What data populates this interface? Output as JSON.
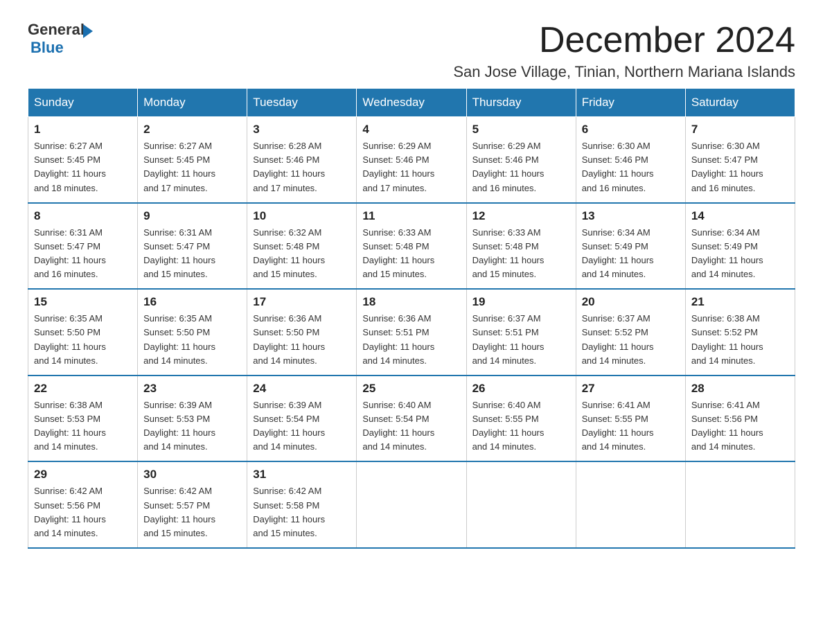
{
  "header": {
    "logo": {
      "general": "General",
      "blue": "Blue",
      "arrow": "▶"
    },
    "month_year": "December 2024",
    "location": "San Jose Village, Tinian, Northern Mariana Islands"
  },
  "weekdays": [
    "Sunday",
    "Monday",
    "Tuesday",
    "Wednesday",
    "Thursday",
    "Friday",
    "Saturday"
  ],
  "weeks": [
    [
      {
        "day": "1",
        "sunrise": "6:27 AM",
        "sunset": "5:45 PM",
        "daylight": "11 hours and 18 minutes."
      },
      {
        "day": "2",
        "sunrise": "6:27 AM",
        "sunset": "5:45 PM",
        "daylight": "11 hours and 17 minutes."
      },
      {
        "day": "3",
        "sunrise": "6:28 AM",
        "sunset": "5:46 PM",
        "daylight": "11 hours and 17 minutes."
      },
      {
        "day": "4",
        "sunrise": "6:29 AM",
        "sunset": "5:46 PM",
        "daylight": "11 hours and 17 minutes."
      },
      {
        "day": "5",
        "sunrise": "6:29 AM",
        "sunset": "5:46 PM",
        "daylight": "11 hours and 16 minutes."
      },
      {
        "day": "6",
        "sunrise": "6:30 AM",
        "sunset": "5:46 PM",
        "daylight": "11 hours and 16 minutes."
      },
      {
        "day": "7",
        "sunrise": "6:30 AM",
        "sunset": "5:47 PM",
        "daylight": "11 hours and 16 minutes."
      }
    ],
    [
      {
        "day": "8",
        "sunrise": "6:31 AM",
        "sunset": "5:47 PM",
        "daylight": "11 hours and 16 minutes."
      },
      {
        "day": "9",
        "sunrise": "6:31 AM",
        "sunset": "5:47 PM",
        "daylight": "11 hours and 15 minutes."
      },
      {
        "day": "10",
        "sunrise": "6:32 AM",
        "sunset": "5:48 PM",
        "daylight": "11 hours and 15 minutes."
      },
      {
        "day": "11",
        "sunrise": "6:33 AM",
        "sunset": "5:48 PM",
        "daylight": "11 hours and 15 minutes."
      },
      {
        "day": "12",
        "sunrise": "6:33 AM",
        "sunset": "5:48 PM",
        "daylight": "11 hours and 15 minutes."
      },
      {
        "day": "13",
        "sunrise": "6:34 AM",
        "sunset": "5:49 PM",
        "daylight": "11 hours and 14 minutes."
      },
      {
        "day": "14",
        "sunrise": "6:34 AM",
        "sunset": "5:49 PM",
        "daylight": "11 hours and 14 minutes."
      }
    ],
    [
      {
        "day": "15",
        "sunrise": "6:35 AM",
        "sunset": "5:50 PM",
        "daylight": "11 hours and 14 minutes."
      },
      {
        "day": "16",
        "sunrise": "6:35 AM",
        "sunset": "5:50 PM",
        "daylight": "11 hours and 14 minutes."
      },
      {
        "day": "17",
        "sunrise": "6:36 AM",
        "sunset": "5:50 PM",
        "daylight": "11 hours and 14 minutes."
      },
      {
        "day": "18",
        "sunrise": "6:36 AM",
        "sunset": "5:51 PM",
        "daylight": "11 hours and 14 minutes."
      },
      {
        "day": "19",
        "sunrise": "6:37 AM",
        "sunset": "5:51 PM",
        "daylight": "11 hours and 14 minutes."
      },
      {
        "day": "20",
        "sunrise": "6:37 AM",
        "sunset": "5:52 PM",
        "daylight": "11 hours and 14 minutes."
      },
      {
        "day": "21",
        "sunrise": "6:38 AM",
        "sunset": "5:52 PM",
        "daylight": "11 hours and 14 minutes."
      }
    ],
    [
      {
        "day": "22",
        "sunrise": "6:38 AM",
        "sunset": "5:53 PM",
        "daylight": "11 hours and 14 minutes."
      },
      {
        "day": "23",
        "sunrise": "6:39 AM",
        "sunset": "5:53 PM",
        "daylight": "11 hours and 14 minutes."
      },
      {
        "day": "24",
        "sunrise": "6:39 AM",
        "sunset": "5:54 PM",
        "daylight": "11 hours and 14 minutes."
      },
      {
        "day": "25",
        "sunrise": "6:40 AM",
        "sunset": "5:54 PM",
        "daylight": "11 hours and 14 minutes."
      },
      {
        "day": "26",
        "sunrise": "6:40 AM",
        "sunset": "5:55 PM",
        "daylight": "11 hours and 14 minutes."
      },
      {
        "day": "27",
        "sunrise": "6:41 AM",
        "sunset": "5:55 PM",
        "daylight": "11 hours and 14 minutes."
      },
      {
        "day": "28",
        "sunrise": "6:41 AM",
        "sunset": "5:56 PM",
        "daylight": "11 hours and 14 minutes."
      }
    ],
    [
      {
        "day": "29",
        "sunrise": "6:42 AM",
        "sunset": "5:56 PM",
        "daylight": "11 hours and 14 minutes."
      },
      {
        "day": "30",
        "sunrise": "6:42 AM",
        "sunset": "5:57 PM",
        "daylight": "11 hours and 15 minutes."
      },
      {
        "day": "31",
        "sunrise": "6:42 AM",
        "sunset": "5:58 PM",
        "daylight": "11 hours and 15 minutes."
      },
      null,
      null,
      null,
      null
    ]
  ],
  "labels": {
    "sunrise": "Sunrise:",
    "sunset": "Sunset:",
    "daylight": "Daylight:"
  },
  "colors": {
    "header_bg": "#2176ae",
    "border": "#2176ae"
  }
}
